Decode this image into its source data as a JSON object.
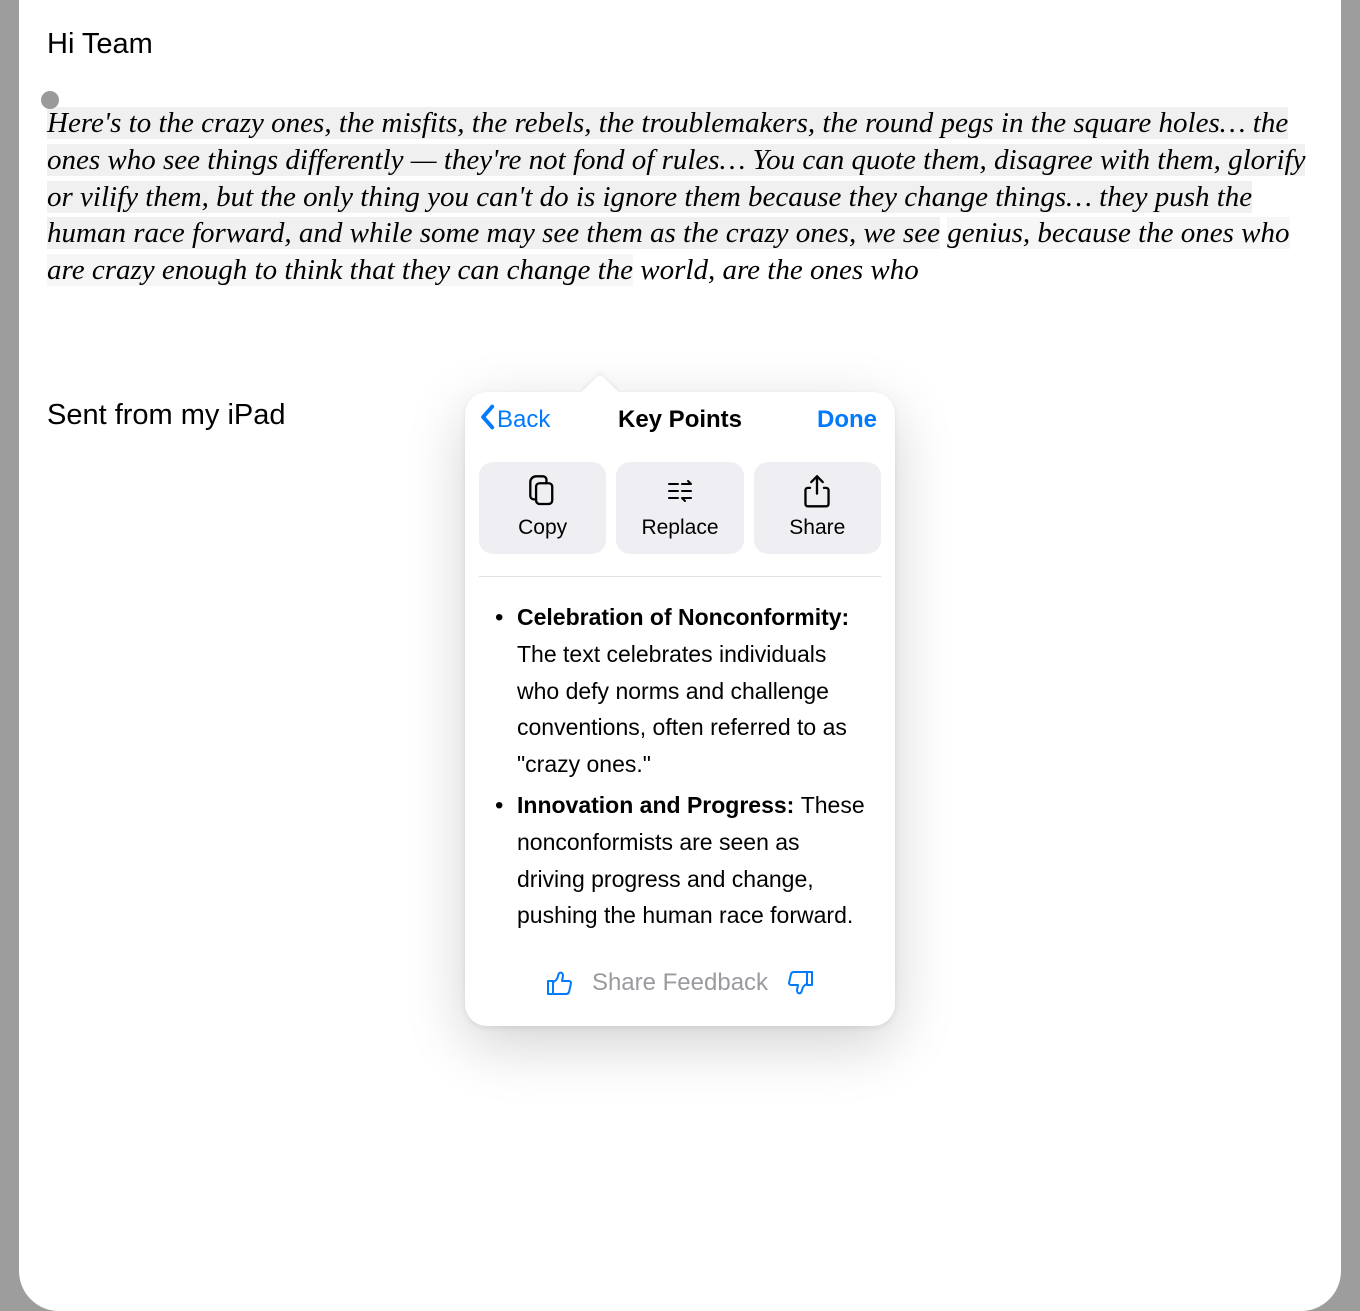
{
  "greeting": "Hi Team",
  "quote": {
    "part_a": "Here's to the crazy ones, the misfits, the rebels, the troublemakers, the round pegs in the square holes… the ones who see things differently — they're not fond of rules… You can quote them, disagree with them, glorify or vilify them, but the only thing you can't do is ignore them because they change things… they push the human race forward, and while some may see them as the crazy ones, we see",
    "part_b": "genius, because the ones who are crazy enough to think that they can change the",
    "part_c": "world, are the ones who"
  },
  "signature": "Sent from my iPad",
  "popover": {
    "back_label": "Back",
    "title": "Key Points",
    "done_label": "Done",
    "actions": {
      "copy": "Copy",
      "replace": "Replace",
      "share": "Share"
    },
    "keypoints": [
      {
        "title": "Celebration of Nonconformity: ",
        "body": "The text celebrates individuals who defy norms and challenge conventions, often referred to as \"crazy ones.\""
      },
      {
        "title": "Innovation and Progress: ",
        "body": "These nonconformists are seen as driving progress and change, pushing the human race forward."
      }
    ],
    "feedback_label": "Share Feedback"
  }
}
